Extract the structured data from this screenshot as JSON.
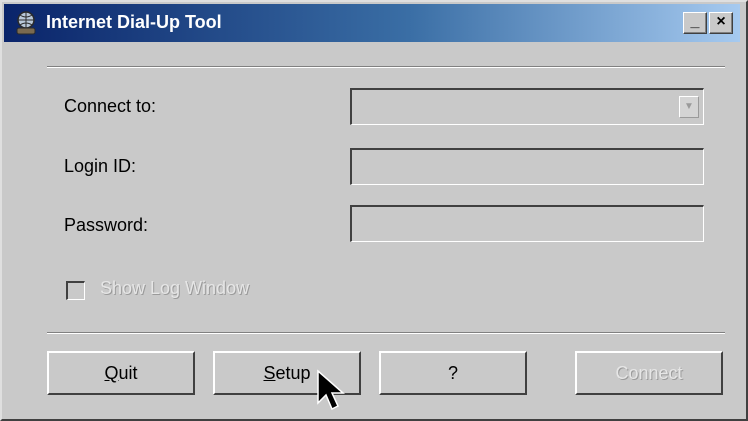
{
  "window": {
    "title": "Internet Dial-Up Tool",
    "minimize_glyph": "_",
    "close_glyph": "×"
  },
  "form": {
    "connect_to": {
      "label": "Connect to:",
      "value": ""
    },
    "login_id": {
      "label": "Login ID:",
      "value": ""
    },
    "password": {
      "label": "Password:",
      "value": ""
    },
    "show_log": {
      "label": "Show Log Window",
      "checked": false,
      "enabled": false
    }
  },
  "buttons": {
    "quit": {
      "mnemonic": "Q",
      "rest": "uit"
    },
    "setup": {
      "mnemonic": "S",
      "rest": "etup"
    },
    "help": {
      "label": "?"
    },
    "connect": {
      "label": "Connect",
      "enabled": false
    }
  },
  "icons": {
    "title": "dialup-globe-icon",
    "dropdown": "chevron-down-icon",
    "cursor": "mouse-pointer-icon"
  },
  "colors": {
    "face": "#c9c9c9",
    "titlebar_start": "#0a246a",
    "titlebar_end": "#a6caf0",
    "disabled_text": "#e6e6e6"
  }
}
